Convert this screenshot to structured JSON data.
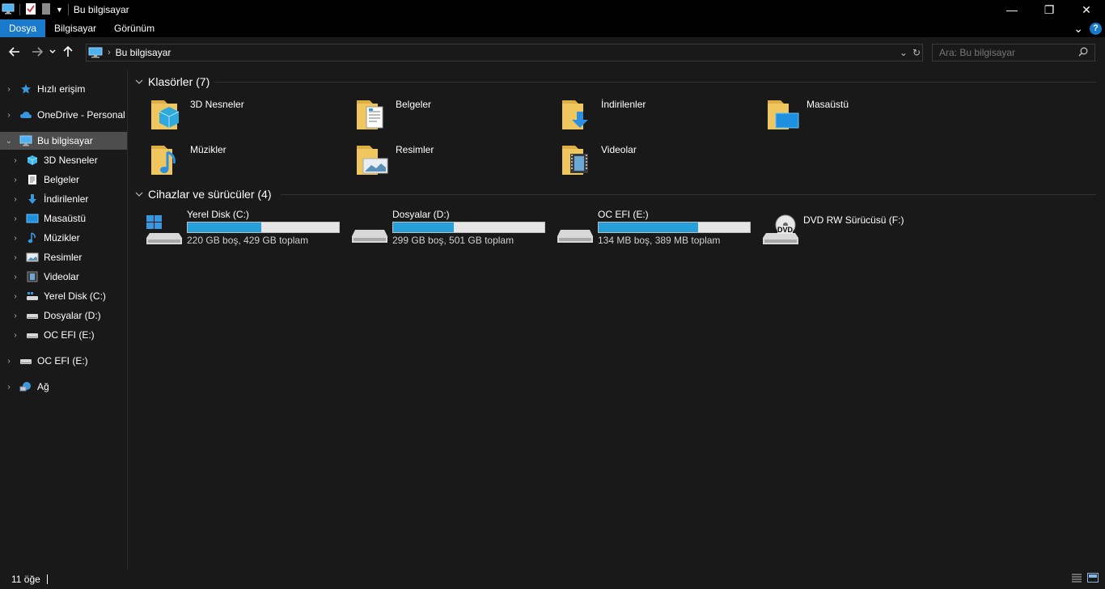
{
  "window": {
    "title": "Bu bilgisayar",
    "minimize": "—",
    "restore": "❐",
    "close": "✕"
  },
  "ribbon": {
    "tabs": [
      {
        "label": "Dosya",
        "active": true
      },
      {
        "label": "Bilgisayar",
        "active": false
      },
      {
        "label": "Görünüm",
        "active": false
      }
    ],
    "expand": "⌄",
    "help": "?"
  },
  "address": {
    "path": "Bu bilgisayar",
    "separator": "›",
    "dropdown": "⌄",
    "refresh": "↻"
  },
  "search": {
    "placeholder": "Ara: Bu bilgisayar"
  },
  "sidebar": {
    "items": [
      {
        "label": "Hızlı erişim",
        "icon": "star-icon"
      },
      {
        "label": "OneDrive - Personal",
        "icon": "cloud-icon"
      },
      {
        "label": "Bu bilgisayar",
        "icon": "computer-icon",
        "selected": true
      },
      {
        "label": "3D Nesneler",
        "icon": "cube-icon"
      },
      {
        "label": "Belgeler",
        "icon": "document-icon"
      },
      {
        "label": "İndirilenler",
        "icon": "download-icon"
      },
      {
        "label": "Masaüstü",
        "icon": "desktop-icon"
      },
      {
        "label": "Müzikler",
        "icon": "music-icon"
      },
      {
        "label": "Resimler",
        "icon": "pictures-icon"
      },
      {
        "label": "Videolar",
        "icon": "video-icon"
      },
      {
        "label": "Yerel Disk (C:)",
        "icon": "windows-drive-icon"
      },
      {
        "label": "Dosyalar (D:)",
        "icon": "drive-icon"
      },
      {
        "label": "OC EFI (E:)",
        "icon": "drive-icon"
      },
      {
        "label": "OC EFI (E:)",
        "icon": "drive-icon"
      },
      {
        "label": "Ağ",
        "icon": "network-icon"
      }
    ]
  },
  "folders_group": {
    "title": "Klasörler (7)",
    "items": [
      {
        "label": "3D Nesneler",
        "icon": "cube-folder-icon"
      },
      {
        "label": "Belgeler",
        "icon": "documents-folder-icon"
      },
      {
        "label": "İndirilenler",
        "icon": "downloads-folder-icon"
      },
      {
        "label": "Masaüstü",
        "icon": "desktop-folder-icon"
      },
      {
        "label": "Müzikler",
        "icon": "music-folder-icon"
      },
      {
        "label": "Resimler",
        "icon": "pictures-folder-icon"
      },
      {
        "label": "Videolar",
        "icon": "videos-folder-icon"
      }
    ]
  },
  "drives_group": {
    "title": "Cihazlar ve sürücüler (4)",
    "items": [
      {
        "label": "Yerel Disk (C:)",
        "info": "220 GB boş, 429 GB toplam",
        "used_fraction": 0.487,
        "icon": "windows-drive-icon"
      },
      {
        "label": "Dosyalar (D:)",
        "info": "299 GB boş, 501 GB toplam",
        "used_fraction": 0.403,
        "icon": "drive-icon"
      },
      {
        "label": "OC EFI (E:)",
        "info": "134 MB boş, 389 MB toplam",
        "used_fraction": 0.656,
        "icon": "drive-icon"
      },
      {
        "label": "DVD RW Sürücüsü (F:)",
        "info": "",
        "icon": "dvd-drive-icon",
        "dvd_text": "DVD"
      }
    ]
  },
  "status": {
    "count": "11 öğe"
  },
  "colors": {
    "accent": "#1979ca",
    "bar_fill": "#26a0da",
    "folder": "#f0c75e",
    "background": "#191919"
  }
}
